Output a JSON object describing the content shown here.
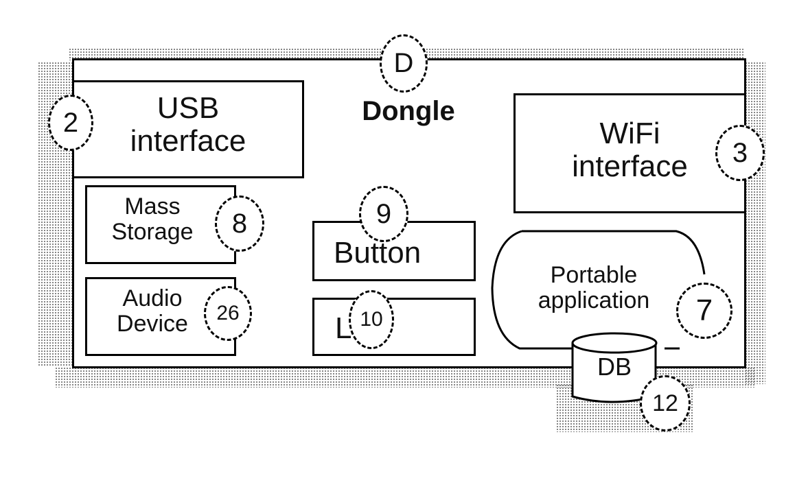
{
  "title": "Dongle",
  "title_ref": "D",
  "components": [
    {
      "id": "usb",
      "label_lines": [
        "USB",
        "interface"
      ],
      "ref": "2"
    },
    {
      "id": "wifi",
      "label_lines": [
        "WiFi",
        "interface"
      ],
      "ref": "3"
    },
    {
      "id": "mass-storage",
      "label_lines": [
        "Mass",
        "Storage"
      ],
      "ref": "8"
    },
    {
      "id": "button",
      "label_lines": [
        "Button"
      ],
      "ref": "9"
    },
    {
      "id": "audio",
      "label_lines": [
        "Audio",
        "Device"
      ],
      "ref": "26"
    },
    {
      "id": "led",
      "label_lines": [
        "LED"
      ],
      "ref": "10"
    },
    {
      "id": "portable-app",
      "label_lines": [
        "Portable",
        "application"
      ],
      "ref": "7"
    },
    {
      "id": "db",
      "label_lines": [
        "DB"
      ],
      "ref": "12"
    }
  ]
}
